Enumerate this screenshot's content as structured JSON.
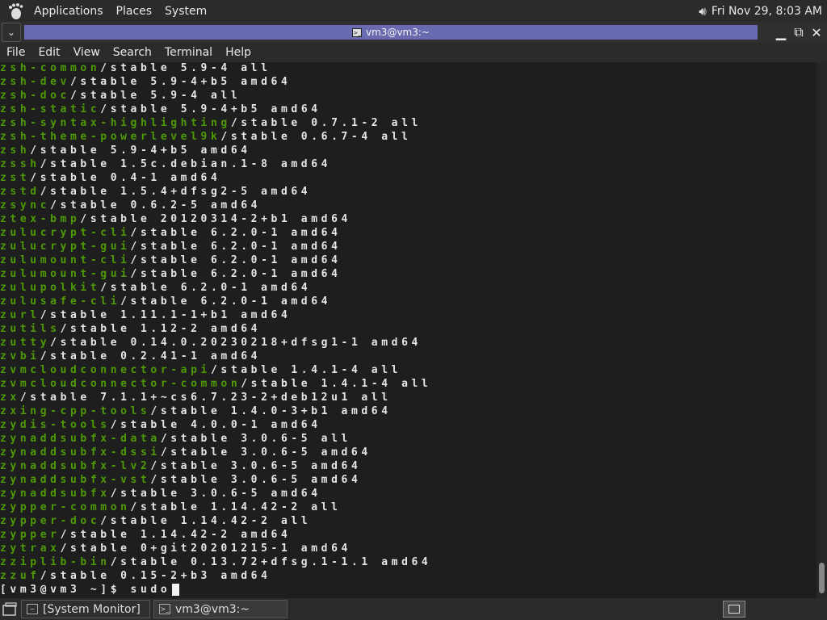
{
  "top_panel": {
    "menus": [
      "Applications",
      "Places",
      "System"
    ],
    "clock": "Fri Nov 29,  8:03 AM"
  },
  "window": {
    "title": "vm3@vm3:~"
  },
  "menubar": {
    "items": [
      "File",
      "Edit",
      "View",
      "Search",
      "Terminal",
      "Help"
    ]
  },
  "terminal": {
    "lines": [
      {
        "pkg": "zsh-common",
        "rest": "/stable 5.9-4 all"
      },
      {
        "pkg": "zsh-dev",
        "rest": "/stable 5.9-4+b5 amd64"
      },
      {
        "pkg": "zsh-doc",
        "rest": "/stable 5.9-4 all"
      },
      {
        "pkg": "zsh-static",
        "rest": "/stable 5.9-4+b5 amd64"
      },
      {
        "pkg": "zsh-syntax-highlighting",
        "rest": "/stable 0.7.1-2 all"
      },
      {
        "pkg": "zsh-theme-powerlevel9k",
        "rest": "/stable 0.6.7-4 all"
      },
      {
        "pkg": "zsh",
        "rest": "/stable 5.9-4+b5 amd64"
      },
      {
        "pkg": "zssh",
        "rest": "/stable 1.5c.debian.1-8 amd64"
      },
      {
        "pkg": "zst",
        "rest": "/stable 0.4-1 amd64"
      },
      {
        "pkg": "zstd",
        "rest": "/stable 1.5.4+dfsg2-5 amd64"
      },
      {
        "pkg": "zsync",
        "rest": "/stable 0.6.2-5 amd64"
      },
      {
        "pkg": "ztex-bmp",
        "rest": "/stable 20120314-2+b1 amd64"
      },
      {
        "pkg": "zulucrypt-cli",
        "rest": "/stable 6.2.0-1 amd64"
      },
      {
        "pkg": "zulucrypt-gui",
        "rest": "/stable 6.2.0-1 amd64"
      },
      {
        "pkg": "zulumount-cli",
        "rest": "/stable 6.2.0-1 amd64"
      },
      {
        "pkg": "zulumount-gui",
        "rest": "/stable 6.2.0-1 amd64"
      },
      {
        "pkg": "zulupolkit",
        "rest": "/stable 6.2.0-1 amd64"
      },
      {
        "pkg": "zulusafe-cli",
        "rest": "/stable 6.2.0-1 amd64"
      },
      {
        "pkg": "zurl",
        "rest": "/stable 1.11.1-1+b1 amd64"
      },
      {
        "pkg": "zutils",
        "rest": "/stable 1.12-2 amd64"
      },
      {
        "pkg": "zutty",
        "rest": "/stable 0.14.0.20230218+dfsg1-1 amd64"
      },
      {
        "pkg": "zvbi",
        "rest": "/stable 0.2.41-1 amd64"
      },
      {
        "pkg": "zvmcloudconnector-api",
        "rest": "/stable 1.4.1-4 all"
      },
      {
        "pkg": "zvmcloudconnector-common",
        "rest": "/stable 1.4.1-4 all"
      },
      {
        "pkg": "zx",
        "rest": "/stable 7.1.1+~cs6.7.23-2+deb12u1 all"
      },
      {
        "pkg": "zxing-cpp-tools",
        "rest": "/stable 1.4.0-3+b1 amd64"
      },
      {
        "pkg": "zydis-tools",
        "rest": "/stable 4.0.0-1 amd64"
      },
      {
        "pkg": "zynaddsubfx-data",
        "rest": "/stable 3.0.6-5 all"
      },
      {
        "pkg": "zynaddsubfx-dssi",
        "rest": "/stable 3.0.6-5 amd64"
      },
      {
        "pkg": "zynaddsubfx-lv2",
        "rest": "/stable 3.0.6-5 amd64"
      },
      {
        "pkg": "zynaddsubfx-vst",
        "rest": "/stable 3.0.6-5 amd64"
      },
      {
        "pkg": "zynaddsubfx",
        "rest": "/stable 3.0.6-5 amd64"
      },
      {
        "pkg": "zypper-common",
        "rest": "/stable 1.14.42-2 all"
      },
      {
        "pkg": "zypper-doc",
        "rest": "/stable 1.14.42-2 all"
      },
      {
        "pkg": "zypper",
        "rest": "/stable 1.14.42-2 amd64"
      },
      {
        "pkg": "zytrax",
        "rest": "/stable 0+git20201215-1 amd64"
      },
      {
        "pkg": "zziplib-bin",
        "rest": "/stable 0.13.72+dfsg.1-1.1 amd64"
      },
      {
        "pkg": "zzuf",
        "rest": "/stable 0.15-2+b3 amd64"
      }
    ],
    "prompt": "[vm3@vm3 ~]$ sudo"
  },
  "taskbar": {
    "tasks": [
      {
        "label": "[System Monitor]",
        "icon": "system-monitor-icon"
      },
      {
        "label": "vm3@vm3:~",
        "icon": "terminal-icon"
      }
    ]
  },
  "colors": {
    "package_name": "#4e9a06",
    "terminal_text": "#e6e6e6",
    "title_highlight": "#6a6ab0"
  }
}
